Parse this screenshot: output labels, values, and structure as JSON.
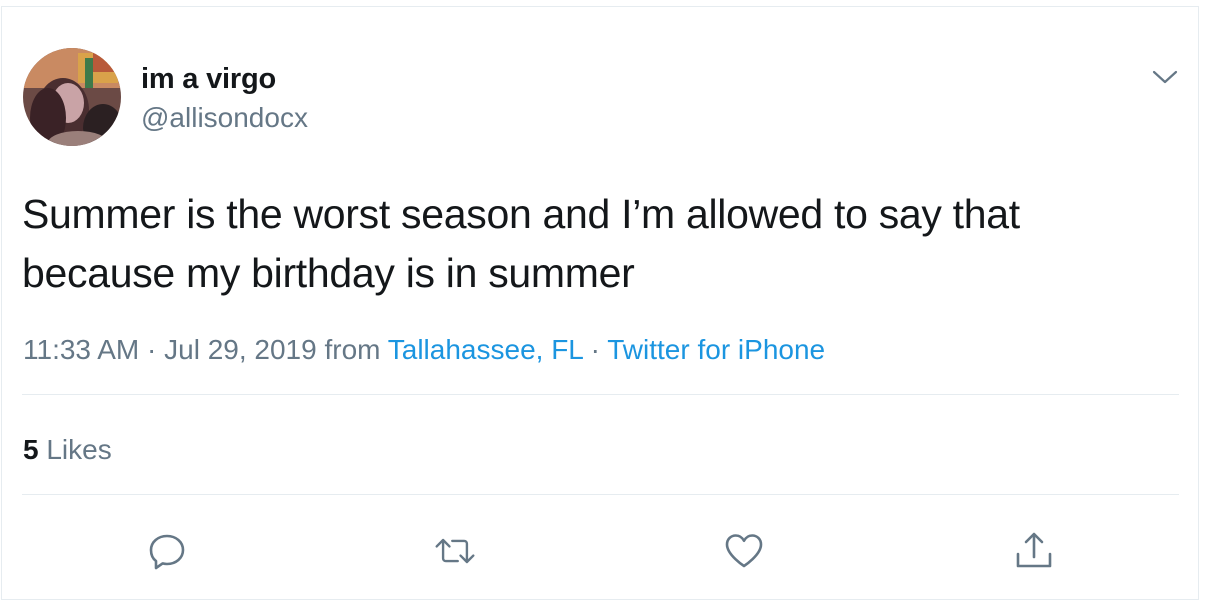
{
  "tweet": {
    "author": {
      "display_name": "im a virgo",
      "handle": "@allisondocx"
    },
    "text": "Summer is the worst season and I’m allowed to say that because my birthday is in summer",
    "time": "11:33 AM",
    "separator": "·",
    "date": "Jul 29, 2019",
    "from_label": "from",
    "location": "Tallahassee, FL",
    "source": "Twitter for iPhone",
    "likes_count": "5",
    "likes_label": "Likes"
  },
  "icons": {
    "more": "chevron-down-icon",
    "reply": "reply-icon",
    "retweet": "retweet-icon",
    "like": "heart-icon",
    "share": "share-icon"
  },
  "colors": {
    "text": "#14171a",
    "secondary": "#657786",
    "link": "#1b95e0",
    "border": "#e6ecf0"
  }
}
